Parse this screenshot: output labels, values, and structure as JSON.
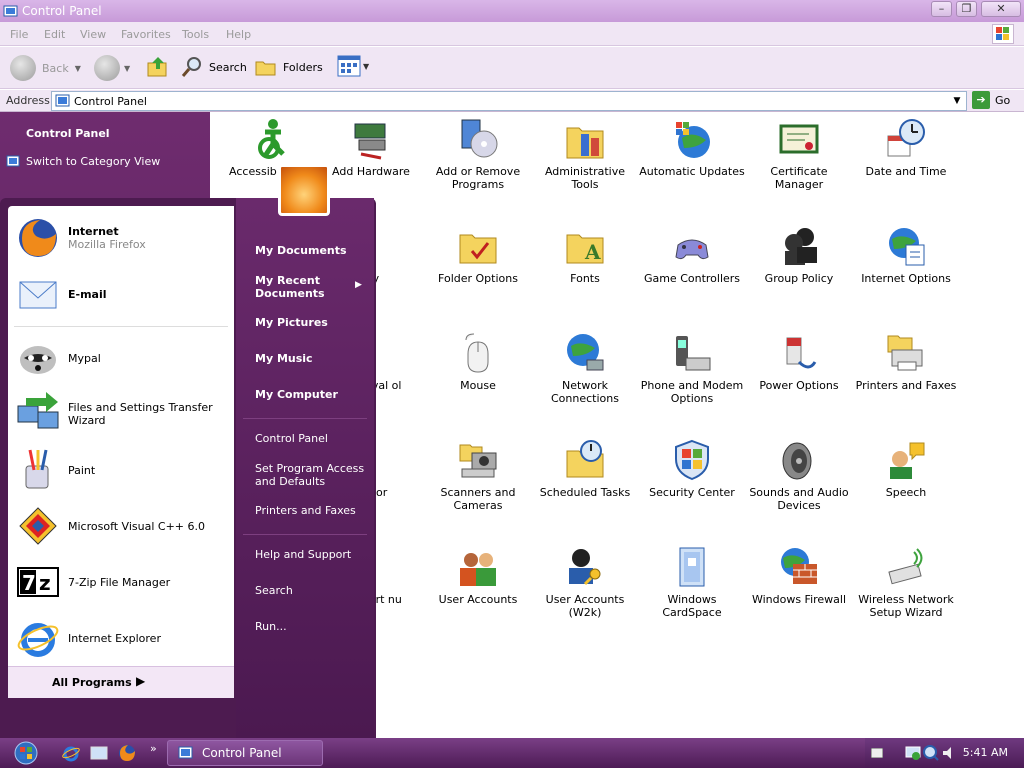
{
  "window": {
    "title": "Control Panel"
  },
  "menu": [
    "File",
    "Edit",
    "View",
    "Favorites",
    "Tools",
    "Help"
  ],
  "toolbar": {
    "back": "Back",
    "search": "Search",
    "folders": "Folders"
  },
  "address": {
    "label": "Address",
    "value": "Control Panel",
    "go": "Go"
  },
  "left_pane": {
    "title": "Control Panel",
    "switch_link": "Switch to Category View"
  },
  "cp_items": {
    "r0": [
      "Accessib Option",
      "Add Hardware",
      "Add or Remove Programs",
      "Administrative Tools",
      "Automatic Updates",
      "Certificate Manager",
      "Date and Time"
    ],
    "r1": [
      "lay",
      "Folder Options",
      "Fonts",
      "Game Controllers",
      "Group Policy",
      "Internet Options"
    ],
    "r2": [
      "Removal ol",
      "Mouse",
      "Network Connections",
      "Phone and Modem Options",
      "Power Options",
      "Printers and Faxes"
    ],
    "r3": [
      "Editor",
      "Scanners and Cameras",
      "Scheduled Tasks",
      "Security Center",
      "Sounds and Audio Devices",
      "Speech"
    ],
    "r4": [
      "nd Start nu",
      "User Accounts",
      "User Accounts (W2k)",
      "Windows CardSpace",
      "Windows Firewall",
      "Wireless Network Setup Wizard"
    ]
  },
  "start_menu": {
    "pinned": [
      {
        "name": "Internet",
        "sub": "Mozilla Firefox"
      },
      {
        "name": "E-mail"
      }
    ],
    "recent": [
      "Mypal",
      "Files and Settings Transfer Wizard",
      "Paint",
      "Microsoft Visual C++ 6.0",
      "7-Zip File Manager",
      "Internet Explorer"
    ],
    "all_programs": "All Programs",
    "right": {
      "my_documents": "My Documents",
      "my_recent": "My Recent Documents",
      "my_pictures": "My Pictures",
      "my_music": "My Music",
      "my_computer": "My Computer",
      "control_panel": "Control Panel",
      "set_program": "Set Program Access and Defaults",
      "printers": "Printers and Faxes",
      "help": "Help and Support",
      "search": "Search",
      "run": "Run..."
    }
  },
  "taskbar": {
    "item": "Control Panel",
    "time": "5:41 AM"
  },
  "colors": {
    "accent": "#6f2c6f",
    "taskbar": "#5b2466",
    "titlebar": "#c79ad8"
  }
}
